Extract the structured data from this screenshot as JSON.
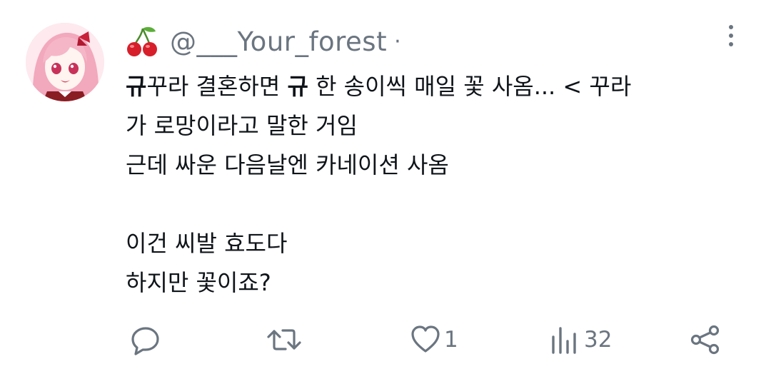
{
  "tweet": {
    "author": {
      "display_emoji": "cherry",
      "handle": "@___Your_forest",
      "separator": "·"
    },
    "body": {
      "line1_part1": "규",
      "line1_part2": "꾸라 결혼하면 ",
      "line1_part3": "규",
      "line1_part4": " 한 송이씩 매일 꽃 사옴... < 꾸라",
      "line2": "가 로망이라고 말한 거임",
      "line3": "근데 싸운 다음날엔 카네이션 사옴",
      "line5": "이건 씨발 효도다",
      "line6": "하지만 꽃이죠?"
    },
    "actions": {
      "reply": {
        "icon": "reply-icon",
        "count": ""
      },
      "retweet": {
        "icon": "retweet-icon",
        "count": ""
      },
      "like": {
        "icon": "heart-icon",
        "count": "1"
      },
      "views": {
        "icon": "views-icon",
        "count": "32"
      },
      "share": {
        "icon": "share-icon",
        "count": ""
      }
    },
    "colors": {
      "text": "#0f1419",
      "secondary": "#6b7580",
      "cherry": "#d71f2b",
      "leaf": "#5cae3a"
    }
  }
}
